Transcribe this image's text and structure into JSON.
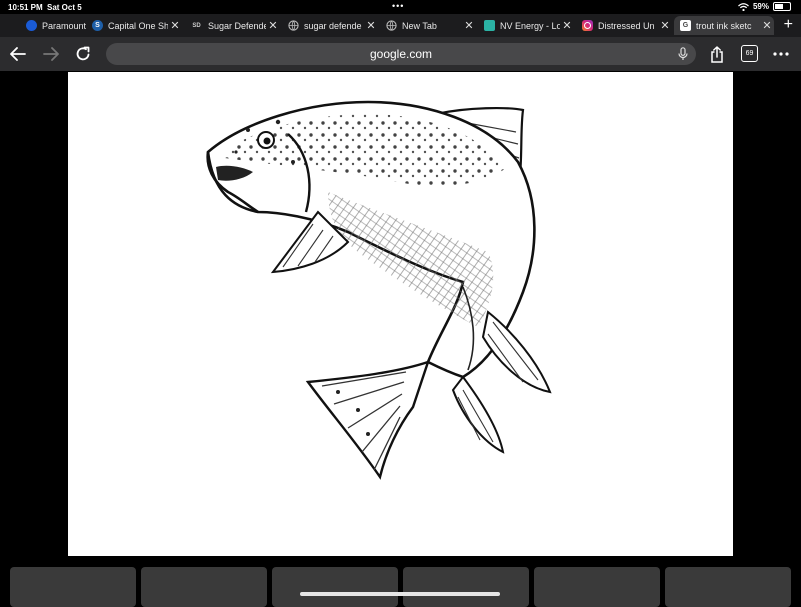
{
  "status": {
    "time": "10:51 PM",
    "date": "Sat Oct 5",
    "battery": "59%",
    "battery_level": 0.59
  },
  "tabs": [
    {
      "label": "Paramount",
      "favicon_color": "#1a5bd6",
      "favicon_text": "",
      "favicon_icon": "paramount-icon"
    },
    {
      "label": "Capital One Sh",
      "favicon_color": "#1e5fa8",
      "favicon_text": "S",
      "favicon_icon": "capital-one-icon"
    },
    {
      "label": "Sugar Defende",
      "favicon_color": "",
      "favicon_text": "SD",
      "favicon_icon": "sugar-defender-icon"
    },
    {
      "label": "sugar defende",
      "favicon_color": "#8e8e93",
      "favicon_text": "",
      "favicon_icon": "globe-icon"
    },
    {
      "label": "New Tab",
      "favicon_color": "#8e8e93",
      "favicon_text": "",
      "favicon_icon": "globe-icon"
    },
    {
      "label": "NV Energy - Lo",
      "favicon_color": "#2bb3a5",
      "favicon_text": "",
      "favicon_icon": "nv-energy-icon"
    },
    {
      "label": "Distressed Un",
      "favicon_color": "#d62976",
      "favicon_text": "",
      "favicon_icon": "instagram-icon"
    },
    {
      "label": "trout ink sketc",
      "favicon_color": "#ffffff",
      "favicon_text": "G",
      "favicon_icon": "google-icon",
      "active": true
    }
  ],
  "toolbar": {
    "url": "google.com",
    "tab_count": "69"
  },
  "colors": {
    "background": "#000000",
    "toolbar": "#2c2c2e",
    "tab_strip": "#1c1c1e",
    "omnibox": "#48484a"
  },
  "image": {
    "subject": "trout ink sketch"
  }
}
